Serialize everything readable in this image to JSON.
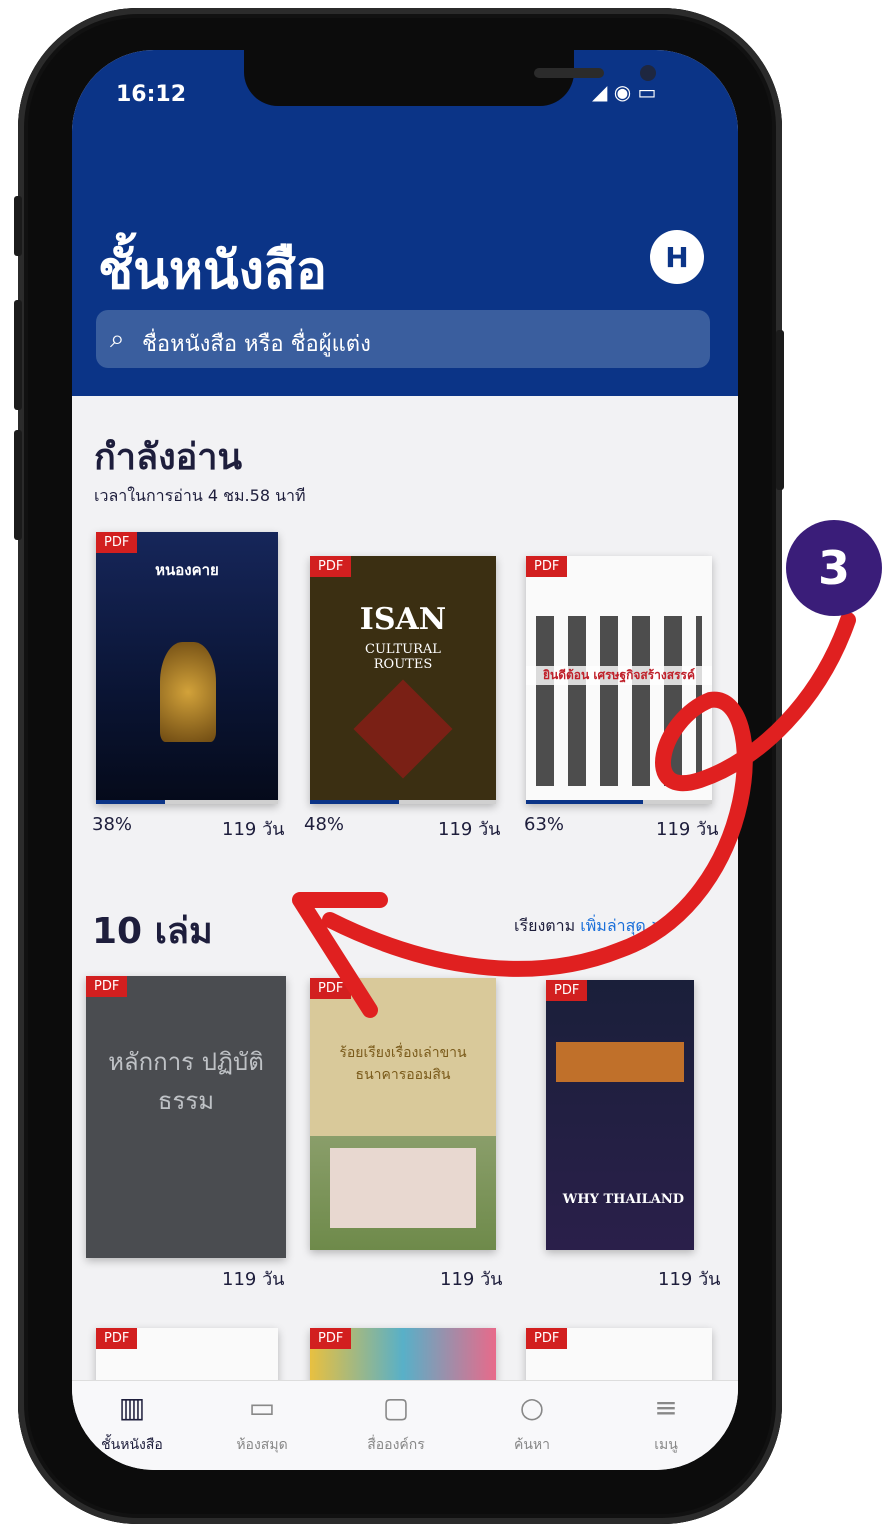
{
  "status": {
    "time": "16:12",
    "icons": "◢ ◉ ▭"
  },
  "header": {
    "title": "ชั้นหนังสือ",
    "logo_text": "H"
  },
  "search": {
    "placeholder": "ชื่อหนังสือ หรือ ชื่อผู้แต่ง"
  },
  "reading": {
    "title": "กำลังอ่าน",
    "subtitle": "เวลาในการอ่าน 4 ชม.58 นาที",
    "books": [
      {
        "badge": "PDF",
        "cover_title": "หนองคาย",
        "percent": "38%",
        "days": "119 วัน",
        "progress": 0.38
      },
      {
        "badge": "PDF",
        "cover_title": "ISAN",
        "cover_sub": "CULTURAL ROUTES",
        "percent": "48%",
        "days": "119 วัน",
        "progress": 0.48
      },
      {
        "badge": "PDF",
        "cover_title": "ยินดีต้อน เศรษฐกิจสร้างสรรค์",
        "percent": "63%",
        "days": "119 วัน",
        "progress": 0.63
      }
    ]
  },
  "library": {
    "title": "10 เล่ม",
    "sort_label": "เรียงตาม",
    "sort_value": "เพิ่มล่าสุด >",
    "books": [
      {
        "badge": "PDF",
        "cover_title": "หลักการ ปฏิบัติธรรม",
        "days": "119 วัน"
      },
      {
        "badge": "PDF",
        "cover_title": "ร้อยเรียงเรื่องเล่าขาน ธนาคารออมสิน",
        "days": "119 วัน"
      },
      {
        "badge": "PDF",
        "cover_title": "WHY THAILAND",
        "days": "119 วัน"
      }
    ],
    "row3": [
      {
        "badge": "PDF"
      },
      {
        "badge": "PDF"
      },
      {
        "badge": "PDF"
      }
    ]
  },
  "tabs": [
    {
      "label": "ชั้นหนังสือ",
      "icon": "bookshelf-icon",
      "glyph": "▥"
    },
    {
      "label": "ห้องสมุด",
      "icon": "library-icon",
      "glyph": "▭"
    },
    {
      "label": "สื่อองค์กร",
      "icon": "organization-media-icon",
      "glyph": "▢"
    },
    {
      "label": "ค้นหา",
      "icon": "search-icon",
      "glyph": "○"
    },
    {
      "label": "เมนู",
      "icon": "menu-icon",
      "glyph": "≡"
    }
  ],
  "annotation": {
    "step": "3",
    "color": "#e02020"
  }
}
